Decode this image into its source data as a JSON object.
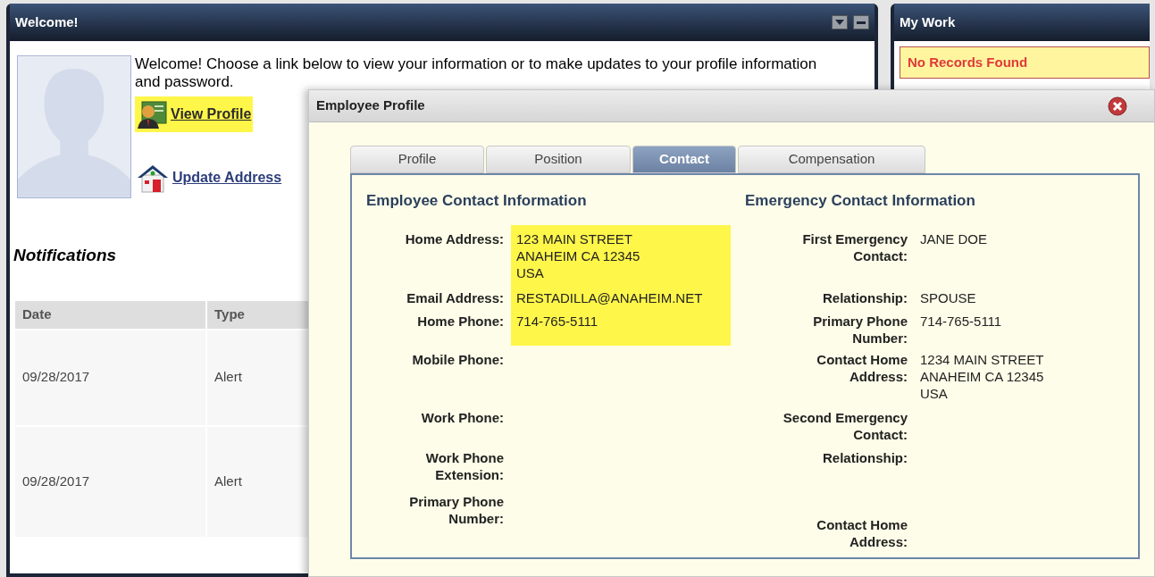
{
  "welcome_panel": {
    "title": "Welcome!",
    "intro": "Welcome! Choose a link below to view your information or to make updates to your profile information and password.",
    "links": [
      {
        "label": "View Profile",
        "kind": "profile",
        "highlighted": true
      },
      {
        "label": "Update Address",
        "kind": "house",
        "highlighted": false
      }
    ],
    "notifications": {
      "title": "Notifications",
      "columns": [
        "Date",
        "Type"
      ],
      "rows": [
        [
          "09/28/2017",
          "Alert"
        ],
        [
          "09/28/2017",
          "Alert"
        ]
      ]
    }
  },
  "my_work_panel": {
    "title": "My Work",
    "message": "No Records Found"
  },
  "dialog": {
    "title": "Employee Profile",
    "tabs": [
      {
        "label": "Profile",
        "selected": false
      },
      {
        "label": "Position",
        "selected": false
      },
      {
        "label": "Contact",
        "selected": true
      },
      {
        "label": "Compensation",
        "selected": false
      }
    ],
    "sections": [
      {
        "heading": "Employee Contact Information",
        "fields": [
          {
            "label": "Home Address:",
            "value": [
              "123 MAIN STREET",
              "ANAHEIM CA 12345",
              "USA"
            ],
            "highlighted": true
          },
          {
            "label": "Email Address:",
            "value": [
              "RESTADILLA@ANAHEIM.NET"
            ],
            "highlighted": true
          },
          {
            "label": "Home Phone:",
            "value": [
              "714-765-5111"
            ],
            "highlighted": true
          },
          {
            "label": "Mobile Phone:",
            "highlighted": false
          },
          {
            "label": "Work Phone:",
            "highlighted": false
          },
          {
            "label": "Work Phone Extension:",
            "highlighted": false
          },
          {
            "label": "Primary Phone Number:",
            "highlighted": false
          }
        ]
      },
      {
        "heading": "Emergency Contact Information",
        "fields": [
          {
            "label": "First Emergency Contact:",
            "value": [
              "JANE DOE"
            ],
            "highlighted": false
          },
          {
            "label": "Relationship:",
            "value": [
              "SPOUSE"
            ],
            "highlighted": false
          },
          {
            "label": "Primary Phone Number:",
            "value": [
              "714-765-5111"
            ],
            "highlighted": false
          },
          {
            "label": "Contact Home Address:",
            "value": [
              "1234 MAIN STREET",
              "ANAHEIM CA 12345",
              "USA"
            ],
            "highlighted": false
          },
          {
            "label": "Second Emergency Contact:",
            "highlighted": false
          },
          {
            "label": "Relationship:",
            "highlighted": false
          },
          {
            "label": "Contact Home Address:",
            "highlighted": false
          }
        ]
      }
    ]
  }
}
